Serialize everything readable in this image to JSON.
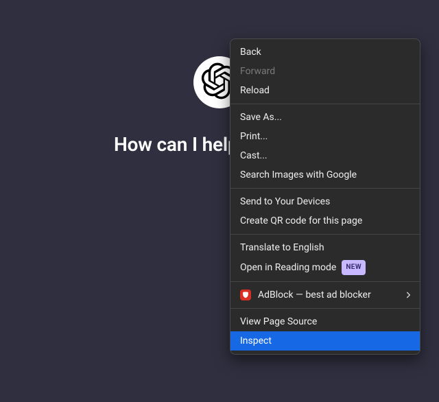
{
  "page": {
    "headline": "How can I help you today"
  },
  "context_menu": {
    "items": {
      "back": {
        "label": "Back",
        "disabled": false
      },
      "forward": {
        "label": "Forward",
        "disabled": true
      },
      "reload": {
        "label": "Reload",
        "disabled": false
      },
      "save_as": {
        "label": "Save As...",
        "disabled": false
      },
      "print": {
        "label": "Print...",
        "disabled": false
      },
      "cast": {
        "label": "Cast...",
        "disabled": false
      },
      "search_img": {
        "label": "Search Images with Google",
        "disabled": false
      },
      "send_dev": {
        "label": "Send to Your Devices",
        "disabled": false
      },
      "qr": {
        "label": "Create QR code for this page",
        "disabled": false
      },
      "translate": {
        "label": "Translate to English",
        "disabled": false
      },
      "reading": {
        "label": "Open in Reading mode",
        "disabled": false,
        "badge": "NEW"
      },
      "adblock": {
        "label": "AdBlock — best ad blocker",
        "disabled": false,
        "submenu": true
      },
      "view_source": {
        "label": "View Page Source",
        "disabled": false
      },
      "inspect": {
        "label": "Inspect",
        "disabled": false,
        "selected": true
      }
    }
  }
}
